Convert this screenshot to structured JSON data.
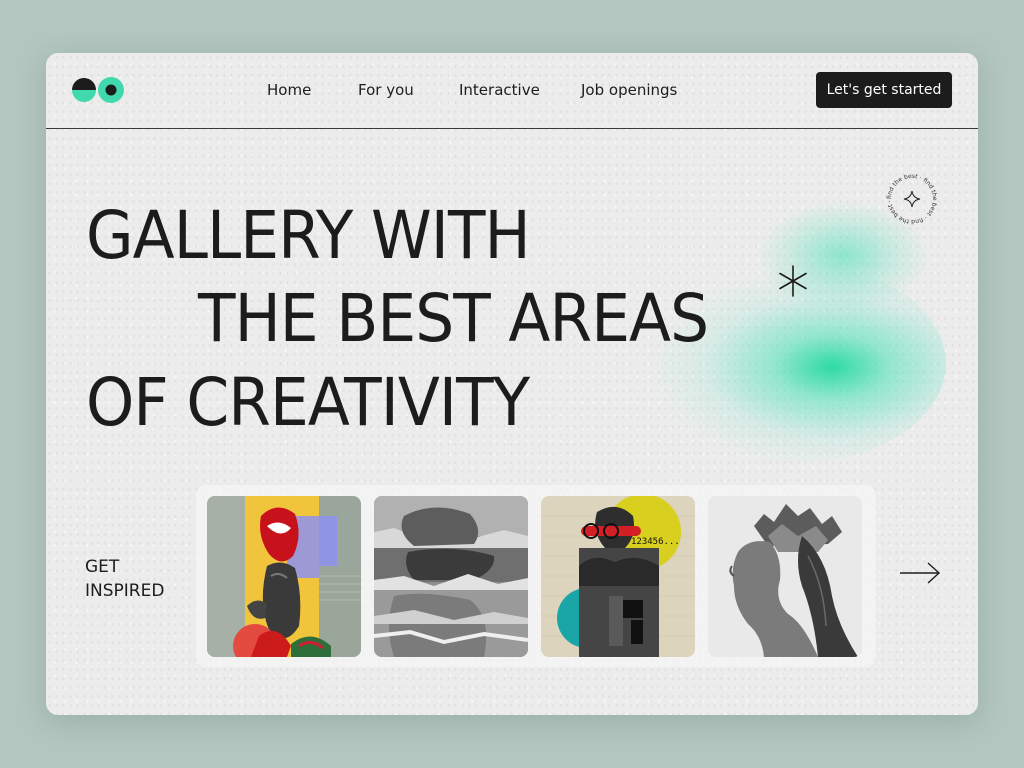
{
  "nav": {
    "links": [
      "Home",
      "For you",
      "Interactive",
      "Job openings"
    ],
    "cta_label": "Let's get started"
  },
  "badge": {
    "ring_text": "find the best · find the best · find the best ·"
  },
  "hero": {
    "line1": "GALLERY WITH",
    "line2": "THE BEST AREAS",
    "line3": "OF CREATIVITY"
  },
  "gallery": {
    "label_line1": "GET",
    "label_line2": "INSPIRED",
    "card3_caption": "123456..."
  },
  "colors": {
    "accent": "#3fd9ad",
    "dark": "#1c1c1c",
    "background": "#b3c6c0"
  },
  "icons": [
    "logo-icon",
    "sparkle-icon",
    "asterisk-icon",
    "arrow-right-icon"
  ]
}
